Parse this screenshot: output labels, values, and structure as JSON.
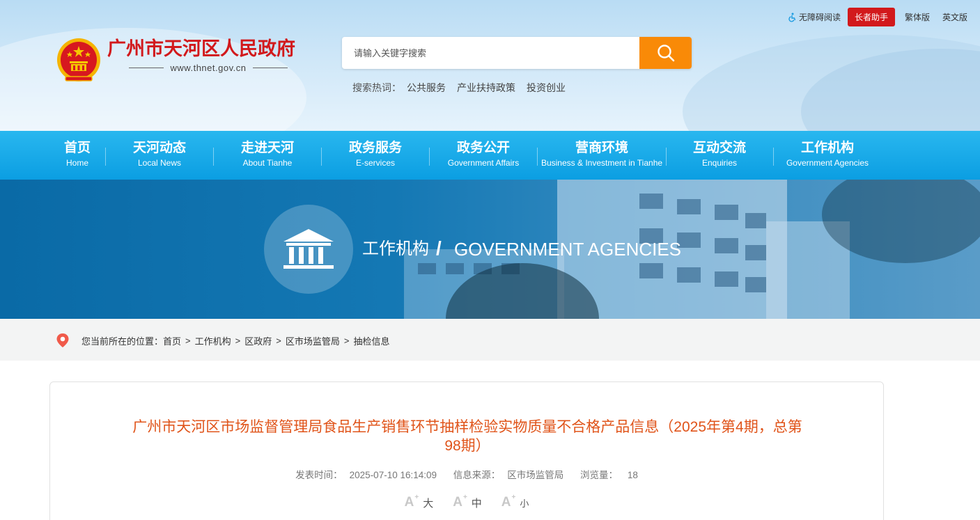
{
  "top_links": {
    "accessibility": "无障碍阅读",
    "elder_mode": "长者助手",
    "traditional": "繁体版",
    "english": "英文版"
  },
  "logo": {
    "title": "广州市天河区人民政府",
    "url": "www.thnet.gov.cn"
  },
  "search": {
    "placeholder": "请输入关键字搜索",
    "hot_label": "搜索热词：",
    "hot_terms": [
      "公共服务",
      "产业扶持政策",
      "投资创业"
    ]
  },
  "nav": [
    {
      "zh": "首页",
      "en": "Home"
    },
    {
      "zh": "天河动态",
      "en": "Local News"
    },
    {
      "zh": "走进天河",
      "en": "About Tianhe"
    },
    {
      "zh": "政务服务",
      "en": "E-services"
    },
    {
      "zh": "政务公开",
      "en": "Government Affairs"
    },
    {
      "zh": "营商环境",
      "en": "Business & Investment in Tianhe"
    },
    {
      "zh": "互动交流",
      "en": "Enquiries"
    },
    {
      "zh": "工作机构",
      "en": "Government Agencies"
    }
  ],
  "banner": {
    "zh": "工作机构",
    "slash": "/",
    "en": "GOVERNMENT AGENCIES"
  },
  "breadcrumb": {
    "prefix": "您当前所在的位置：",
    "items": [
      "首页",
      "工作机构",
      "区政府",
      "区市场监管局",
      "抽检信息"
    ],
    "separator": ">"
  },
  "article": {
    "title_line1": "广州市天河区市场监督管理局食品生产销售环节抽样检验实物质量不合格产品信息（2025年第4期，总第",
    "title_line2": "98期）",
    "publish_label": "发表时间：",
    "publish_time": "2025-07-10 16:14:09",
    "source_label": "信息来源：",
    "source": "区市场监管局",
    "views_label": "浏览量：",
    "views": "18",
    "font_sizes": [
      {
        "mark": "A",
        "plus": "+",
        "label": "大"
      },
      {
        "mark": "A",
        "plus": "+",
        "label": "中"
      },
      {
        "mark": "A",
        "plus": "+",
        "label": "小"
      }
    ]
  },
  "colors": {
    "brand_red": "#d2191c",
    "search_orange": "#f98a07",
    "nav_blue": "#0b9ee2",
    "title_orange": "#e0541a"
  }
}
